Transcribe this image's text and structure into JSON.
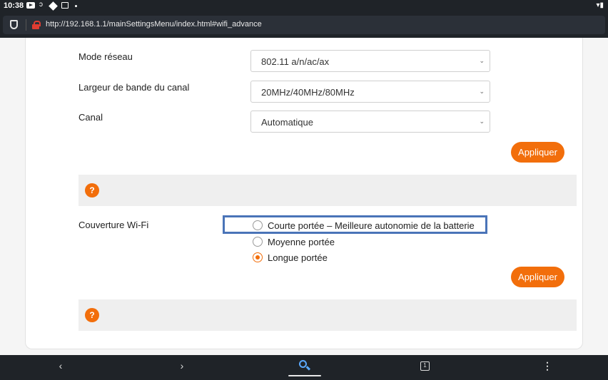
{
  "status_bar": {
    "time": "10:38",
    "icons": [
      "youtube-icon",
      "chat-icon",
      "tag-icon",
      "image-icon",
      "dot-icon"
    ],
    "right_icons": [
      "signal-icon",
      "wifi-icon",
      "battery-icon"
    ]
  },
  "browser": {
    "url": "http://192.168.1.1/mainSettingsMenu/index.html#wifi_advance"
  },
  "form": {
    "mode_label": "Mode réseau",
    "mode_value": "802.11 a/n/ac/ax",
    "bandwidth_label": "Largeur de bande du canal",
    "bandwidth_value": "20MHz/40MHz/80MHz",
    "channel_label": "Canal",
    "channel_value": "Automatique",
    "apply_label": "Appliquer"
  },
  "help": {
    "icon_text": "?"
  },
  "coverage": {
    "label": "Couverture Wi-Fi",
    "options": [
      {
        "label": "Courte portée – Meilleure autonomie de la batterie",
        "checked": false
      },
      {
        "label": "Moyenne portée",
        "checked": false
      },
      {
        "label": "Longue portée",
        "checked": true
      }
    ],
    "apply_label": "Appliquer"
  },
  "navbar": {
    "back": "‹",
    "forward": "›",
    "tabs_count": "1",
    "menu": "⋮"
  },
  "colors": {
    "accent": "#f26e0b",
    "highlight_border": "#4a74b8",
    "chrome_bg": "#1f2328"
  }
}
